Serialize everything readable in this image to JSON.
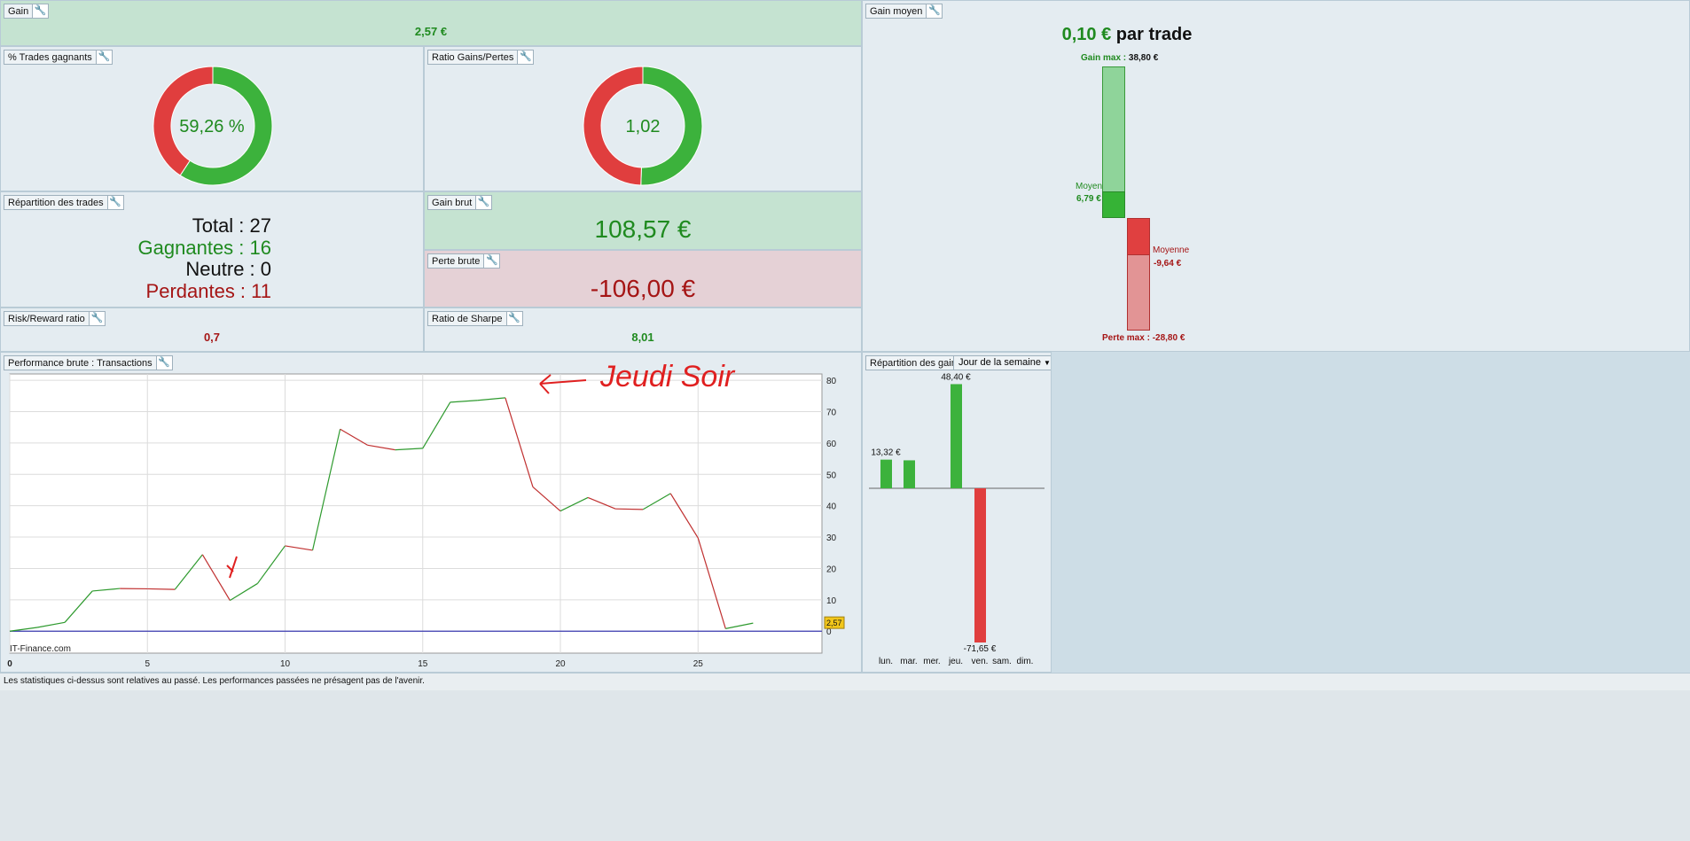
{
  "gain": {
    "title": "Gain",
    "value": "2,57 €"
  },
  "trades_gagnants": {
    "title": "% Trades gagnants",
    "value": "59,26 %",
    "fraction": 0.5926
  },
  "ratio_gains_pertes": {
    "title": "Ratio Gains/Pertes",
    "value": "1,02",
    "fraction": 0.5053
  },
  "repartition_trades": {
    "title": "Répartition des trades",
    "total": "Total : 27",
    "gagnantes": "Gagnantes : 16",
    "neutre": "Neutre : 0",
    "perdantes": "Perdantes : 11"
  },
  "gain_brut": {
    "title": "Gain brut",
    "value": "108,57 €"
  },
  "perte_brute": {
    "title": "Perte brute",
    "value": "-106,00 €"
  },
  "risk_reward": {
    "title": "Risk/Reward ratio",
    "value": "0,7"
  },
  "sharpe": {
    "title": "Ratio de Sharpe",
    "value": "8,01"
  },
  "gain_moyen": {
    "title": "Gain moyen",
    "amount": "0,10 €",
    "suffix": " par trade",
    "gain_max_label": "Gain max : ",
    "gain_max_value": "38,80 €",
    "moyen_label": "Moyen",
    "moyen_value": "6,79 €",
    "moyenne_label": "Moyenne",
    "moyenne_value": "-9,64 €",
    "perte_max_label": "Perte max : ",
    "perte_max_value": "-28,80 €",
    "values": {
      "gain_max": 38.8,
      "moyen": 6.79,
      "moyenne": -9.64,
      "perte_max": -28.8
    }
  },
  "performance": {
    "title": "Performance brute : Transactions",
    "watermark": "IT-Finance.com",
    "last_label": "2,57"
  },
  "chart_data": {
    "type": "line",
    "title": "Performance brute : Transactions",
    "x": [
      0,
      1,
      2,
      3,
      4,
      5,
      6,
      7,
      8,
      9,
      10,
      11,
      12,
      13,
      14,
      15,
      16,
      17,
      18,
      19,
      20,
      21,
      22,
      23,
      24,
      25,
      26,
      27
    ],
    "y": [
      0,
      1.2,
      2.8,
      12.8,
      13.6,
      13.5,
      13.3,
      24.4,
      9.8,
      15.2,
      27.2,
      25.8,
      64.4,
      59.3,
      57.8,
      58.3,
      73.0,
      73.6,
      74.4,
      46.0,
      38.3,
      42.6,
      39.0,
      38.8,
      43.9,
      29.7,
      0.8,
      2.57
    ],
    "xticks": [
      "0",
      "5",
      "10",
      "15",
      "20",
      "25"
    ],
    "yticks": [
      "0",
      "10",
      "20",
      "30",
      "40",
      "50",
      "60",
      "70",
      "80"
    ],
    "xlim": [
      0,
      29.5
    ],
    "ylim": [
      -7,
      82
    ],
    "grid": true,
    "up_color": "#2e9a2e",
    "down_color": "#c03030",
    "baseline_color": "#3a3ab0",
    "annotation": "Jeudi Soir"
  },
  "repartition_gains": {
    "title": "Répartition des gains",
    "dropdown": "Jour de la semaine",
    "days": [
      "lun.",
      "mar.",
      "mer.",
      "jeu.",
      "ven.",
      "sam.",
      "dim."
    ],
    "values": [
      13.32,
      13.0,
      0,
      48.4,
      -71.65,
      0,
      0
    ],
    "labels": [
      "13,32 €",
      "",
      "",
      "48,40 €",
      "-71,65 €",
      "",
      ""
    ]
  },
  "footer": "Les statistiques ci-dessus sont relatives au passé. Les performances passées ne présagent pas de l'avenir."
}
